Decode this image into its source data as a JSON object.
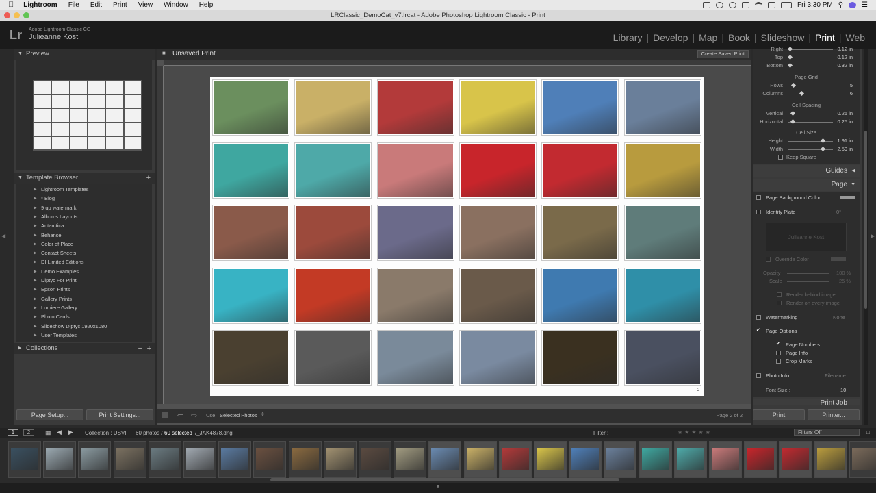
{
  "menubar": {
    "app": "Lightroom",
    "items": [
      "File",
      "Edit",
      "Print",
      "View",
      "Window",
      "Help"
    ],
    "clock": "Fri 3:30 PM"
  },
  "window": {
    "title": "LRClassic_DemoCat_v7.lrcat - Adobe Photoshop Lightroom Classic - Print"
  },
  "identity": {
    "logo": "Lr",
    "product": "Adobe Lightroom Classic CC",
    "user": "Julieanne Kost"
  },
  "modules": [
    "Library",
    "Develop",
    "Map",
    "Book",
    "Slideshow",
    "Print",
    "Web"
  ],
  "active_module": "Print",
  "left_panel": {
    "preview_title": "Preview",
    "template_browser_title": "Template Browser",
    "templates": [
      "Lightroom Templates",
      "* Blog",
      "9 up watermark",
      "Albums Layouts",
      "Antarctica",
      "Behance",
      "Color of Place",
      "Contact Sheets",
      "DI Limited Editions",
      "Demo Examples",
      "Diptyc For Print",
      "Epson Prints",
      "Gallery Prints",
      "Lumiere Gallery",
      "Photo Cards",
      "Slideshow Diptyc 1920x1080",
      "User Templates"
    ],
    "collections_title": "Collections",
    "page_setup": "Page Setup...",
    "print_settings": "Print Settings..."
  },
  "main": {
    "title": "Unsaved Print",
    "create_saved": "Create Saved Print",
    "page_number": "2",
    "toolbar_use_label": "Use:",
    "toolbar_use_value": "Selected Photos",
    "page_indicator": "Page 2 of 2"
  },
  "photos": [
    [
      "#6b8f5e",
      "#c9b067",
      "#b33a3a",
      "#d8c44a",
      "#4f7fb8",
      "#6a7f9a"
    ],
    [
      "#3fa7a0",
      "#4ea9a8",
      "#c97a7a",
      "#c8252b",
      "#c22a30",
      "#b89b3e"
    ],
    [
      "#8a5a4a",
      "#9c4a3c",
      "#6b6a8a",
      "#8a7060",
      "#7a6a4a",
      "#5f7c7a"
    ],
    [
      "#38b3c4",
      "#c33a25",
      "#8a7a6a",
      "#6a5a4a",
      "#3f7ab0",
      "#2f8fa8"
    ],
    [
      "#4a4030",
      "#5a5a5a",
      "#7a8a9a",
      "#7a8aa0",
      "#3a3020",
      "#4a5060"
    ]
  ],
  "right_panel": {
    "margins": [
      {
        "label": "Right",
        "value": "0.12 in"
      },
      {
        "label": "Top",
        "value": "0.12 in"
      },
      {
        "label": "Bottom",
        "value": "0.32 in"
      }
    ],
    "page_grid_title": "Page Grid",
    "page_grid": [
      {
        "label": "Rows",
        "value": "5"
      },
      {
        "label": "Columns",
        "value": "6"
      }
    ],
    "cell_spacing_title": "Cell Spacing",
    "cell_spacing": [
      {
        "label": "Vertical",
        "value": "0.25 in"
      },
      {
        "label": "Horizontal",
        "value": "0.25 in"
      }
    ],
    "cell_size_title": "Cell Size",
    "cell_size": [
      {
        "label": "Height",
        "value": "1.91 in"
      },
      {
        "label": "Width",
        "value": "2.59 in"
      }
    ],
    "keep_square": "Keep Square",
    "guides": "Guides",
    "page": "Page",
    "page_bg": "Page Background Color",
    "identity_plate": "Identity Plate",
    "identity_plate_angle": "0°",
    "identity_text": "Julieanne Kost",
    "override_color": "Override Color",
    "opacity": "Opacity",
    "opacity_val": "100 %",
    "scale": "Scale",
    "scale_val": "25 %",
    "render_behind": "Render behind image",
    "render_every": "Render on every image",
    "watermarking": "Watermarking",
    "watermark_value": "None",
    "page_options": "Page Options",
    "page_numbers": "Page Numbers",
    "page_info": "Page Info",
    "crop_marks": "Crop Marks",
    "photo_info": "Photo Info",
    "photo_info_value": "Filename",
    "font_size": "Font Size :",
    "font_size_value": "10",
    "print_job": "Print Job",
    "print_btn": "Print",
    "printer_btn": "Printer..."
  },
  "filmbar": {
    "page1": "1",
    "page2": "2",
    "collection": "Collection : USVI",
    "count": "60 photos /",
    "selected": "60 selected",
    "file": "/_JAK4878.dng",
    "filter_label": "Filter :",
    "filters_off": "Filters Off"
  },
  "filmstrip": [
    "#3a5060",
    "#9aa8b0",
    "#8a9aa0",
    "#7a7060",
    "#6a7a80",
    "#a0a8b0",
    "#5a7aa0",
    "#6a5040",
    "#8a6a40",
    "#a09070",
    "#5a4a40",
    "#a09a80",
    "#6a8ab0",
    "#c9b067",
    "#b33a3a",
    "#d8c44a",
    "#4f7fb8",
    "#6a7f9a",
    "#3fa7a0",
    "#4ea9a8",
    "#c97a7a",
    "#c8252b",
    "#c22a30",
    "#b89b3e",
    "#7a6a5a"
  ],
  "colors": {
    "accent_selected": "#ffffff",
    "panel": "#3a3a3a",
    "canvas": "#4a4a4a"
  }
}
